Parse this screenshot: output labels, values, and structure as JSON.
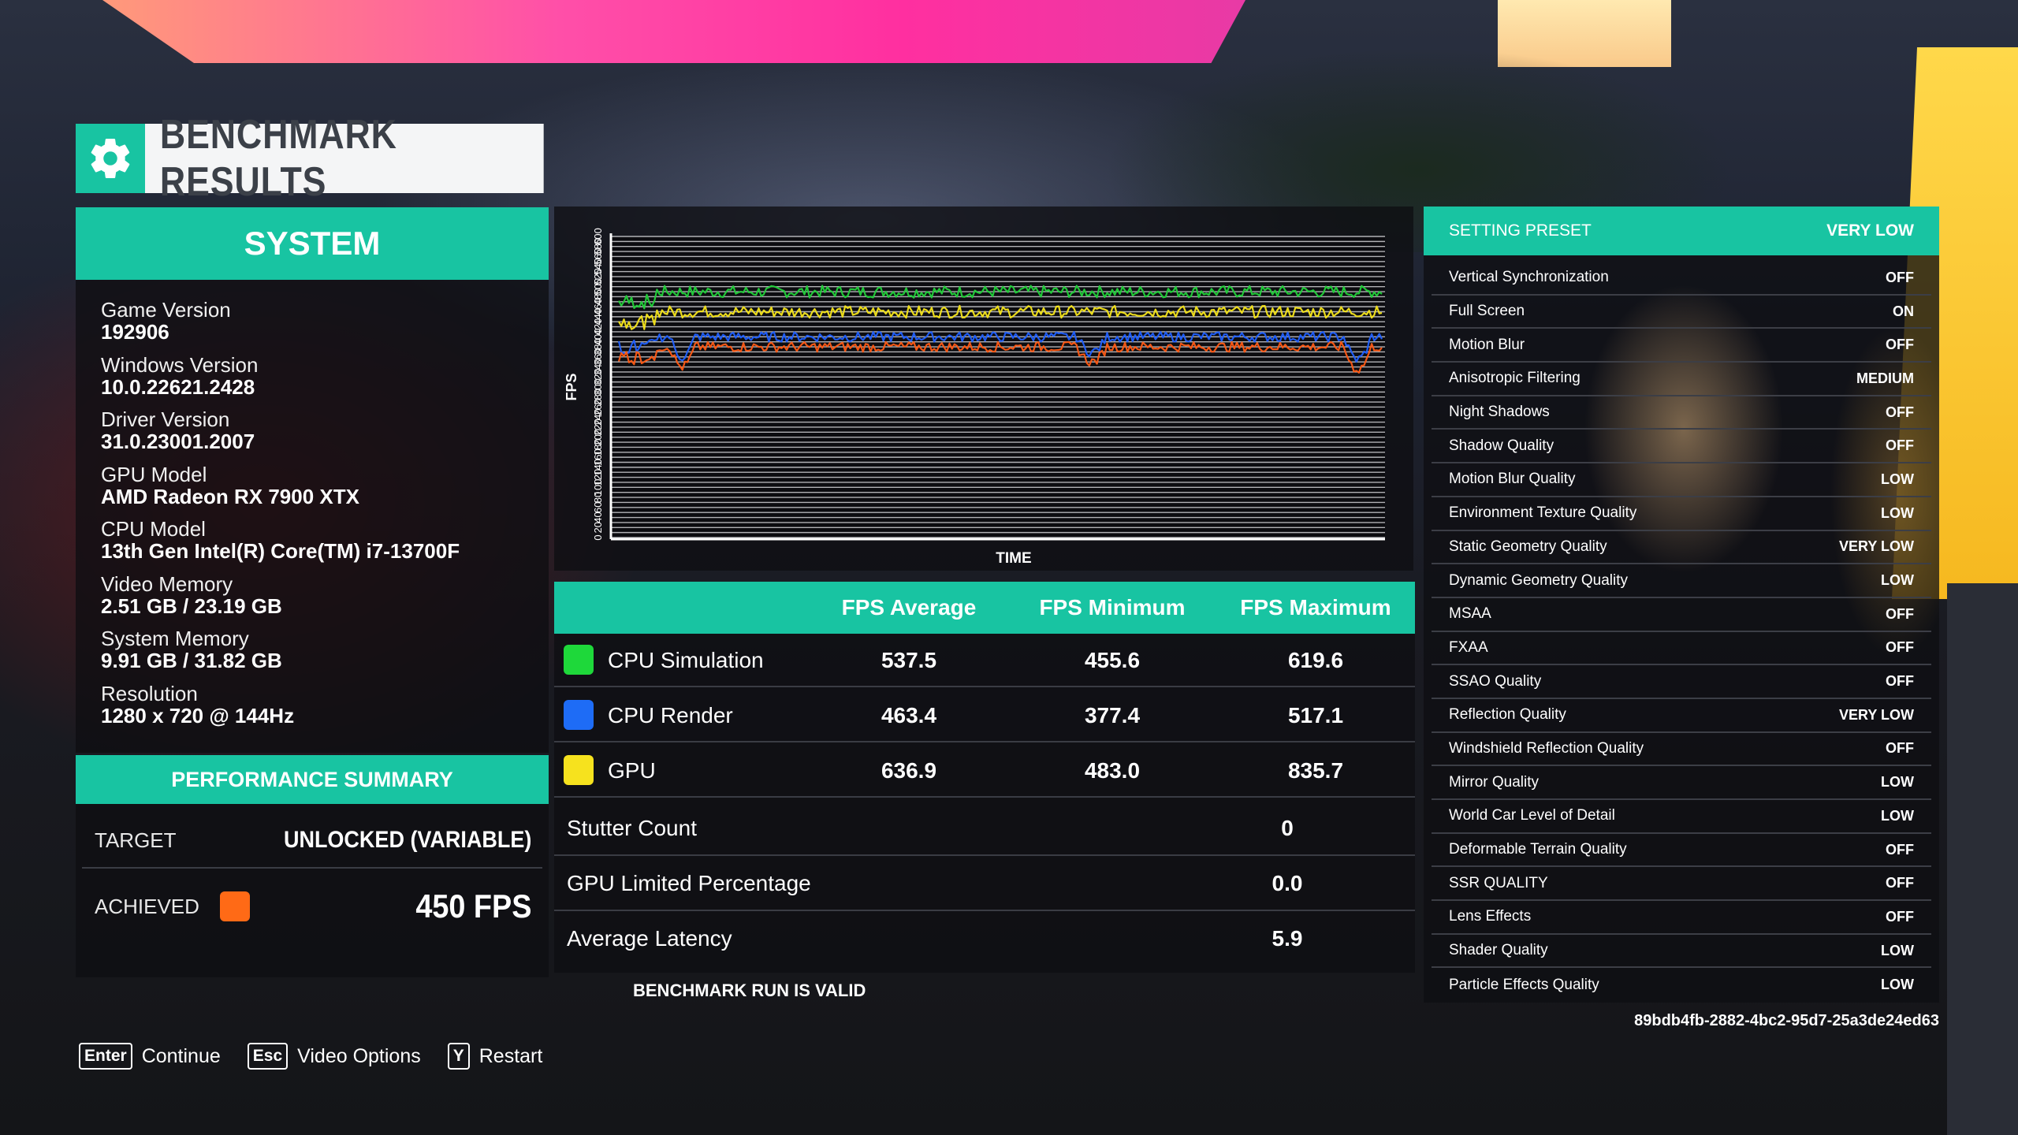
{
  "header": {
    "title": "BENCHMARK RESULTS",
    "icon": "gear-icon"
  },
  "system": {
    "title": "SYSTEM",
    "items": [
      {
        "label": "Game Version",
        "value": "192906"
      },
      {
        "label": "Windows Version",
        "value": "10.0.22621.2428"
      },
      {
        "label": "Driver Version",
        "value": "31.0.23001.2007"
      },
      {
        "label": "GPU Model",
        "value": "AMD Radeon RX 7900 XTX"
      },
      {
        "label": "CPU Model",
        "value": "13th Gen Intel(R) Core(TM) i7-13700F"
      },
      {
        "label": "Video Memory",
        "value": "2.51 GB / 23.19 GB"
      },
      {
        "label": "System Memory",
        "value": "9.91 GB / 31.82 GB"
      },
      {
        "label": "Resolution",
        "value": "1280 x 720 @ 144Hz"
      }
    ]
  },
  "performance": {
    "title": "PERFORMANCE SUMMARY",
    "target_label": "TARGET",
    "target_value": "UNLOCKED (VARIABLE)",
    "achieved_label": "ACHIEVED",
    "achieved_value": "450 FPS",
    "achieved_color": "#ff6a16"
  },
  "chart_data": {
    "type": "line",
    "ylabel": "FPS",
    "xlabel": "TIME",
    "ylim": [
      0,
      600
    ],
    "yticks": [
      600,
      580,
      560,
      540,
      520,
      500,
      480,
      460,
      440,
      420,
      400,
      380,
      360,
      340,
      320,
      300,
      280,
      260,
      240,
      220,
      200,
      180,
      160,
      140,
      120,
      100,
      80,
      60,
      40,
      20,
      0
    ],
    "series": [
      {
        "color": "#22d13a",
        "level": 490,
        "noise": 12
      },
      {
        "color": "#f6e51b",
        "level": 450,
        "noise": 12
      },
      {
        "color": "#2060ff",
        "level": 400,
        "noise": 10
      },
      {
        "color": "#ff5a14",
        "level": 380,
        "noise": 10
      }
    ]
  },
  "results": {
    "columns": [
      "FPS Average",
      "FPS Minimum",
      "FPS Maximum"
    ],
    "rows": [
      {
        "name": "CPU Simulation",
        "color": "#1ed83a",
        "avg": "537.5",
        "min": "455.6",
        "max": "619.6"
      },
      {
        "name": "CPU Render",
        "color": "#1e6cf6",
        "avg": "463.4",
        "min": "377.4",
        "max": "517.1"
      },
      {
        "name": "GPU",
        "color": "#f6e21e",
        "avg": "636.9",
        "min": "483.0",
        "max": "835.7"
      }
    ],
    "stats": [
      {
        "name": "Stutter Count",
        "value": "0"
      },
      {
        "name": "GPU Limited Percentage",
        "value": "0.0"
      },
      {
        "name": "Average Latency",
        "value": "5.9"
      }
    ],
    "valid_text": "BENCHMARK RUN IS VALID"
  },
  "settings": {
    "preset_label": "SETTING PRESET",
    "preset_value": "VERY LOW",
    "items": [
      {
        "label": "Vertical Synchronization",
        "value": "OFF"
      },
      {
        "label": "Full Screen",
        "value": "ON"
      },
      {
        "label": "Motion Blur",
        "value": "OFF"
      },
      {
        "label": "Anisotropic Filtering",
        "value": "MEDIUM"
      },
      {
        "label": "Night Shadows",
        "value": "OFF"
      },
      {
        "label": "Shadow Quality",
        "value": "OFF"
      },
      {
        "label": "Motion Blur Quality",
        "value": "LOW"
      },
      {
        "label": "Environment Texture Quality",
        "value": "LOW"
      },
      {
        "label": "Static Geometry Quality",
        "value": "VERY LOW"
      },
      {
        "label": "Dynamic Geometry Quality",
        "value": "LOW"
      },
      {
        "label": "MSAA",
        "value": "OFF"
      },
      {
        "label": "FXAA",
        "value": "OFF"
      },
      {
        "label": "SSAO Quality",
        "value": "OFF"
      },
      {
        "label": "Reflection Quality",
        "value": "VERY LOW"
      },
      {
        "label": "Windshield Reflection Quality",
        "value": "OFF"
      },
      {
        "label": "Mirror Quality",
        "value": "LOW"
      },
      {
        "label": "World Car Level of Detail",
        "value": "LOW"
      },
      {
        "label": "Deformable Terrain Quality",
        "value": "OFF"
      },
      {
        "label": "SSR QUALITY",
        "value": "OFF"
      },
      {
        "label": "Lens Effects",
        "value": "OFF"
      },
      {
        "label": "Shader Quality",
        "value": "LOW"
      },
      {
        "label": "Particle Effects Quality",
        "value": "LOW"
      }
    ],
    "session_id": "89bdb4fb-2882-4bc2-95d7-25a3de24ed63"
  },
  "footer": {
    "actions": [
      {
        "key": "Enter",
        "label": "Continue"
      },
      {
        "key": "Esc",
        "label": "Video Options"
      },
      {
        "key": "Y",
        "label": "Restart"
      }
    ]
  }
}
